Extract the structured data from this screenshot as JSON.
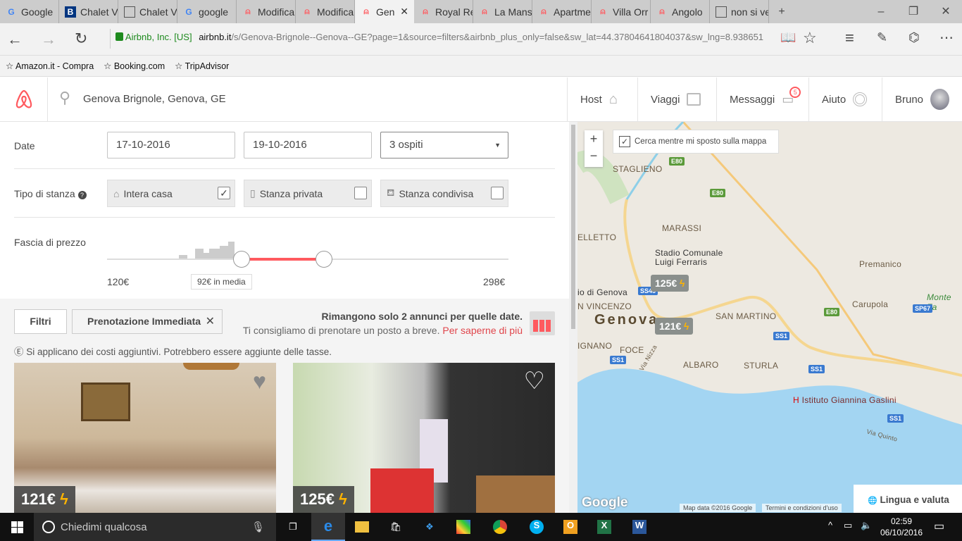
{
  "browser": {
    "tabs": [
      {
        "title": "Google",
        "icon": "google-icon"
      },
      {
        "title": "Chalet V",
        "icon": "booking-icon"
      },
      {
        "title": "Chalet V",
        "icon": "page-icon"
      },
      {
        "title": "google",
        "icon": "google-icon"
      },
      {
        "title": "Modifica",
        "icon": "airbnb-icon"
      },
      {
        "title": "Modifica",
        "icon": "airbnb-icon"
      },
      {
        "title": "Gen",
        "icon": "airbnb-icon",
        "active": true
      },
      {
        "title": "Royal Re",
        "icon": "airbnb-icon"
      },
      {
        "title": "La Mans",
        "icon": "airbnb-icon"
      },
      {
        "title": "Apartme",
        "icon": "airbnb-icon"
      },
      {
        "title": "Villa Orr",
        "icon": "airbnb-icon"
      },
      {
        "title": "Angolo",
        "icon": "airbnb-icon"
      },
      {
        "title": "non si ve",
        "icon": "page-icon"
      }
    ],
    "cert": "Airbnb, Inc. [US]",
    "url_domain": "airbnb.it",
    "url_path": "/s/Genova-Brignole--Genova--GE?page=1&source=filters&airbnb_plus_only=false&sw_lat=44.37804641804037&sw_lng=8.938651",
    "favorites": [
      "Amazon.it - Compra",
      "Booking.com",
      "TripAdvisor"
    ]
  },
  "header": {
    "search": "Genova Brignole, Genova, GE",
    "nav": {
      "host": "Host",
      "trips": "Viaggi",
      "messages": "Messaggi",
      "messages_badge": "5",
      "help": "Aiuto",
      "user": "Bruno"
    }
  },
  "filters": {
    "date_label": "Date",
    "checkin": "17-10-2016",
    "checkout": "19-10-2016",
    "guests": "3 ospiti",
    "room_type_label": "Tipo di stanza",
    "room_types": [
      {
        "label": "Intera casa",
        "checked": true
      },
      {
        "label": "Stanza privata",
        "checked": false
      },
      {
        "label": "Stanza condivisa",
        "checked": false
      }
    ],
    "price_label": "Fascia di prezzo",
    "price_min": "120€",
    "price_max": "298€",
    "avg": "92€ in media",
    "filters_button": "Filtri",
    "instant_chip": "Prenotazione Immediata",
    "notice_title": "Rimangono solo 2 annunci per quelle date.",
    "notice_text": "Ti consigliamo di prenotare un posto a breve.",
    "notice_link": "Per saperne di più",
    "fees_note": "Si applicano dei costi aggiuntivi. Potrebbero essere aggiunte delle tasse."
  },
  "listings": [
    {
      "price": "121€"
    },
    {
      "price": "125€"
    }
  ],
  "map": {
    "search_on_move": "Cerca mentre mi sposto sulla mappa",
    "labels": [
      "STAGLIENO",
      "MARASSI",
      "ELLETTO",
      "Stadio Comunale",
      "Luigi Ferraris",
      "io di Genova",
      "N VINCENZO",
      "Genova",
      "IGNANO",
      "FOCE",
      "ALBARO",
      "STURLA",
      "SAN MARTINO",
      "Premanico",
      "Carupola",
      "Monte Fa",
      "Istituto Giannina Gaslini",
      "Via Nizza",
      "Via Quinto"
    ],
    "markers": [
      "125€",
      "121€"
    ],
    "attribution": "Map data ©2016 Google",
    "terms": "Termini e condizioni d'uso",
    "logo": "Google",
    "language": "Lingua e valuta"
  },
  "taskbar": {
    "search": "Chiedimi qualcosa",
    "time": "02:59",
    "date": "06/10/2016"
  },
  "colors": {
    "brand": "#ff5a5f",
    "instant": "#ffb400"
  }
}
